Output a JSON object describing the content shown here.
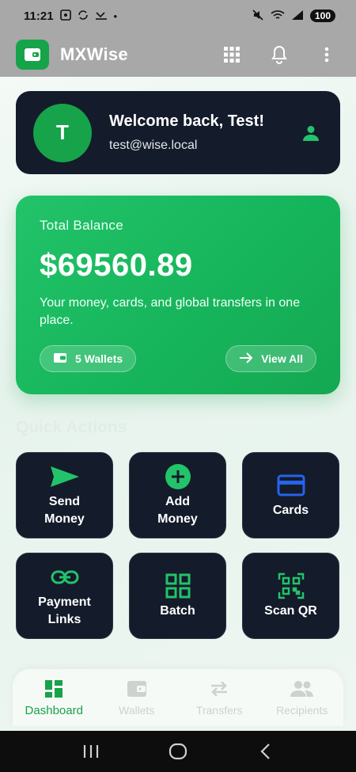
{
  "status_bar": {
    "time": "11:21",
    "battery": "100",
    "dot": "•"
  },
  "app_bar": {
    "title": "MXWise"
  },
  "welcome": {
    "avatar_initial": "T",
    "title": "Welcome back, Test!",
    "email": "test@wise.local"
  },
  "balance": {
    "label": "Total Balance",
    "amount": "$69560.89",
    "description": "Your money, cards, and global transfers in one place.",
    "wallets_button": "5 Wallets",
    "view_all_button": "View All"
  },
  "quick_actions": {
    "title": "Quick Actions",
    "items": [
      {
        "label": "Send\nMoney",
        "icon": "send-icon"
      },
      {
        "label": "Add\nMoney",
        "icon": "add-circle-icon"
      },
      {
        "label": "Cards",
        "icon": "credit-card-icon"
      },
      {
        "label": "Payment\nLinks",
        "icon": "link-icon"
      },
      {
        "label": "Batch",
        "icon": "grid-icon"
      },
      {
        "label": "Scan QR",
        "icon": "qr-code-icon"
      }
    ]
  },
  "bottom_nav": {
    "items": [
      {
        "label": "Dashboard",
        "icon": "dashboard-icon",
        "active": true
      },
      {
        "label": "Wallets",
        "icon": "wallet-icon",
        "active": false
      },
      {
        "label": "Transfers",
        "icon": "transfer-arrows-icon",
        "active": false
      },
      {
        "label": "Recipients",
        "icon": "people-icon",
        "active": false
      }
    ]
  },
  "colors": {
    "accent": "#16a34a",
    "dark_card": "#141b2b",
    "icon_blue": "#2563eb",
    "inactive_nav": "#cbd2cf"
  }
}
